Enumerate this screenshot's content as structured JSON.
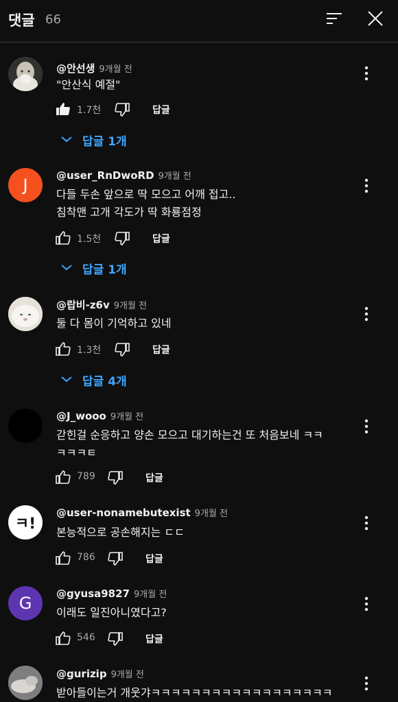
{
  "header": {
    "title": "댓글",
    "count": "66"
  },
  "reply_label": "답글",
  "comments": [
    {
      "author": "@안선생",
      "time": "9개월 전",
      "lines": [
        "\"안산식 예절\""
      ],
      "likes": "1.7천",
      "liked": true,
      "replies": "답글 1개",
      "avatar": {
        "type": "photo-old-man"
      }
    },
    {
      "author": "@user_RnDwoRD",
      "time": "9개월 전",
      "lines": [
        "다들 두손 앞으로 딱 모으고 어깨 접고..",
        "침착맨 고개 각도가 딱 화룡점정"
      ],
      "likes": "1.5천",
      "liked": false,
      "replies": "답글 1개",
      "avatar": {
        "type": "letter",
        "letter": "J",
        "color": "#f4511e"
      }
    },
    {
      "author": "@랍비-z6v",
      "time": "9개월 전",
      "lines": [
        "둘 다 몸이 기억하고 있네"
      ],
      "likes": "1.3천",
      "liked": false,
      "replies": "답글 4개",
      "avatar": {
        "type": "photo-white-dog"
      }
    },
    {
      "author": "@J_wooo",
      "time": "9개월 전",
      "lines": [
        "갇힌걸 순응하고 양손 모으고 대기하는건 또 처음보네 ㅋㅋ",
        "ㅋㅋㅋㅌ"
      ],
      "likes": "789",
      "liked": false,
      "replies": "",
      "avatar": {
        "type": "black"
      }
    },
    {
      "author": "@user-nonamebutexist",
      "time": "9개월 전",
      "lines": [
        "본능적으로 공손해지는 ㄷㄷ"
      ],
      "likes": "786",
      "liked": false,
      "replies": "",
      "avatar": {
        "type": "text-badge",
        "text": "ㅋ!"
      }
    },
    {
      "author": "@gyusa9827",
      "time": "9개월 전",
      "lines": [
        "이래도 일진아니였다고?"
      ],
      "likes": "546",
      "liked": false,
      "replies": "",
      "avatar": {
        "type": "letter",
        "letter": "G",
        "color": "#5e35b1"
      }
    },
    {
      "author": "@gurizip",
      "time": "9개월 전",
      "lines": [
        "받아들이는거 개웃갸ㅋㅋㅋㅋㅋㅋㅋㅋㅋㅋㅋㅋㅋㅋㅋㅋㅋㅋ"
      ],
      "likes": "",
      "liked": false,
      "replies": "",
      "avatar": {
        "type": "photo-gray-animal"
      }
    }
  ]
}
